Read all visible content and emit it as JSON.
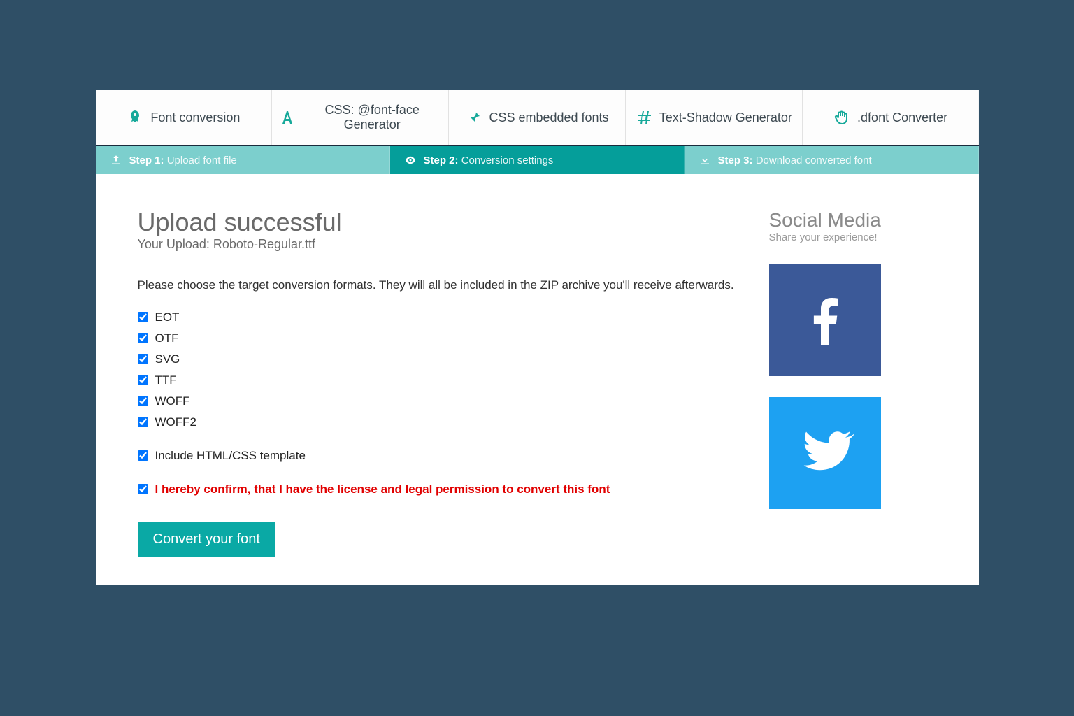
{
  "nav": {
    "items": [
      {
        "label": "Font conversion"
      },
      {
        "label": "CSS: @font-face Generator"
      },
      {
        "label": "CSS embedded fonts"
      },
      {
        "label": "Text-Shadow Generator"
      },
      {
        "label": ".dfont Converter"
      }
    ]
  },
  "steps": {
    "items": [
      {
        "bold": "Step 1:",
        "text": "Upload font file",
        "active": false
      },
      {
        "bold": "Step 2:",
        "text": "Conversion settings",
        "active": true
      },
      {
        "bold": "Step 3:",
        "text": "Download converted font",
        "active": false
      }
    ]
  },
  "main": {
    "title": "Upload successful",
    "subtitle": "Your Upload: Roboto-Regular.ttf",
    "description": "Please choose the target conversion formats. They will all be included in the ZIP archive you'll receive afterwards.",
    "formats": [
      {
        "label": "EOT",
        "checked": true
      },
      {
        "label": "OTF",
        "checked": true
      },
      {
        "label": "SVG",
        "checked": true
      },
      {
        "label": "TTF",
        "checked": true
      },
      {
        "label": "WOFF",
        "checked": true
      },
      {
        "label": "WOFF2",
        "checked": true
      }
    ],
    "include_template_label": "Include HTML/CSS template",
    "include_template_checked": true,
    "license_label": "I hereby confirm, that I have the license and legal permission to convert this font",
    "license_checked": true,
    "convert_button": "Convert your font"
  },
  "sidebar": {
    "title": "Social Media",
    "subtitle": "Share your experience!"
  },
  "colors": {
    "background": "#2f4f66",
    "accent": "#0aa9a5",
    "step_inactive": "#7ccfcd",
    "facebook": "#3b5998",
    "twitter": "#1da1f2",
    "license_text": "#e10000"
  }
}
